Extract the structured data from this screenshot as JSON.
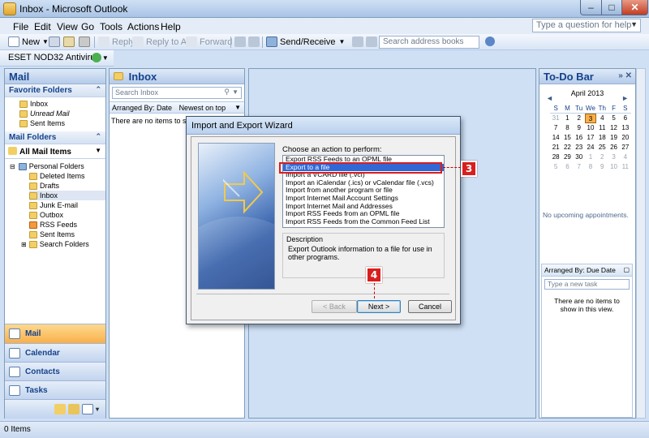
{
  "window": {
    "title": "Inbox - Microsoft Outlook",
    "min_glyph": "–",
    "max_glyph": "□",
    "close_glyph": "✕"
  },
  "menu": {
    "items": [
      "File",
      "Edit",
      "View",
      "Go",
      "Tools",
      "Actions",
      "Help"
    ],
    "help_placeholder": "Type a question for help"
  },
  "toolbar": {
    "new_label": "New",
    "reply_label": "Reply",
    "reply_all_label": "Reply to All",
    "forward_label": "Forward",
    "send_receive_label": "Send/Receive",
    "search_book_placeholder": "Search address books",
    "eset_label": "ESET NOD32 Antivirus"
  },
  "nav": {
    "title": "Mail",
    "favorites_title": "Favorite Folders",
    "favorites": [
      "Inbox",
      "Unread Mail",
      "Sent Items"
    ],
    "mail_folders_title": "Mail Folders",
    "all_mail_label": "All Mail Items",
    "root_label": "Personal Folders",
    "folders": [
      "Deleted Items",
      "Drafts",
      "Inbox",
      "Junk E-mail",
      "Outbox",
      "RSS Feeds",
      "Sent Items",
      "Search Folders"
    ],
    "buttons": [
      "Mail",
      "Calendar",
      "Contacts",
      "Tasks"
    ]
  },
  "inbox": {
    "title": "Inbox",
    "search_placeholder": "Search Inbox",
    "arranged_by": "Arranged By: Date",
    "sort_order": "Newest on top",
    "empty_text": "There are no items to show in this view."
  },
  "todo": {
    "title": "To-Do Bar",
    "calendar_month": "April 2013",
    "day_headers": [
      "S",
      "M",
      "Tu",
      "We",
      "Th",
      "F",
      "S"
    ],
    "weeks": [
      [
        "31",
        "1",
        "2",
        "3",
        "4",
        "5",
        "6"
      ],
      [
        "7",
        "8",
        "9",
        "10",
        "11",
        "12",
        "13"
      ],
      [
        "14",
        "15",
        "16",
        "17",
        "18",
        "19",
        "20"
      ],
      [
        "21",
        "22",
        "23",
        "24",
        "25",
        "26",
        "27"
      ],
      [
        "28",
        "29",
        "30",
        "1",
        "2",
        "3",
        "4"
      ],
      [
        "5",
        "6",
        "7",
        "8",
        "9",
        "10",
        "11"
      ]
    ],
    "today": "3",
    "no_appointments": "No upcoming appointments.",
    "tasks_arranged": "Arranged By: Due Date",
    "task_placeholder": "Type a new task",
    "tasks_empty": "There are no items to show in this view."
  },
  "status": {
    "items_count": "0 Items"
  },
  "dialog": {
    "title": "Import and Export Wizard",
    "choose_label": "Choose an action to perform:",
    "actions": [
      "Export RSS Feeds to an OPML file",
      "Export to a file",
      "Import a VCARD file (.vcf)",
      "Import an iCalendar (.ics) or vCalendar file (.vcs)",
      "Import from another program or file",
      "Import Internet Mail Account Settings",
      "Import Internet Mail and Addresses",
      "Import RSS Feeds from an OPML file",
      "Import RSS Feeds from the Common Feed List"
    ],
    "selected_index": 1,
    "description_title": "Description",
    "description_text": "Export Outlook information to a file for use in other programs.",
    "back_label": "< Back",
    "next_label": "Next >",
    "cancel_label": "Cancel"
  },
  "annotations": {
    "step3": "3",
    "step4": "4",
    "color": "#d81e1e"
  }
}
